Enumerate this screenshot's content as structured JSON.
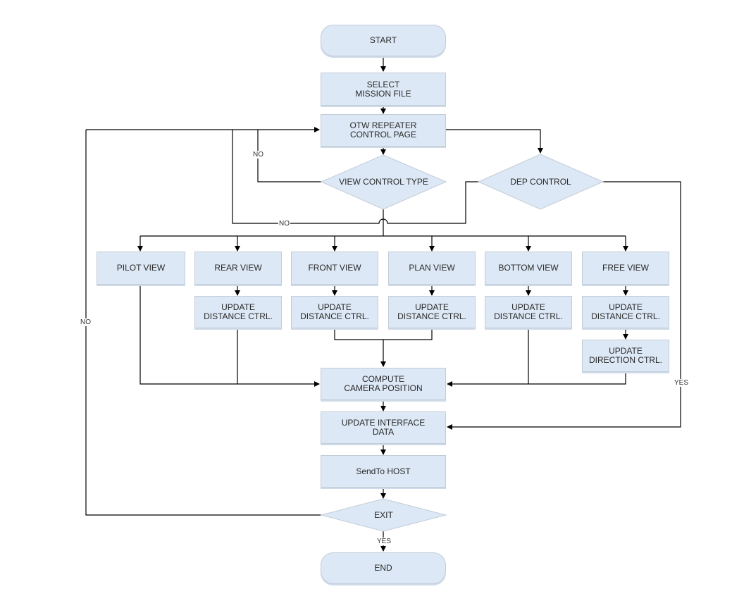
{
  "diagram": {
    "type": "flowchart",
    "nodes": {
      "start": "START",
      "select_mission": "SELECT\nMISSION FILE",
      "otw_control": "OTW REPEATER\nCONTROL PAGE",
      "view_control_type": "VIEW CONTROL TYPE",
      "dep_control": "DEP CONTROL",
      "pilot_view": "PILOT VIEW",
      "rear_view": "REAR VIEW",
      "front_view": "FRONT VIEW",
      "plan_view": "PLAN VIEW",
      "bottom_view": "BOTTOM VIEW",
      "free_view": "FREE VIEW",
      "rear_update_distance": "UPDATE\nDISTANCE CTRL.",
      "front_update_distance": "UPDATE\nDISTANCE CTRL.",
      "plan_update_distance": "UPDATE\nDISTANCE CTRL.",
      "bottom_update_distance": "UPDATE\nDISTANCE CTRL.",
      "free_update_distance": "UPDATE\nDISTANCE CTRL.",
      "free_update_direction": "UPDATE\nDIRECTION CTRL.",
      "compute_camera": "COMPUTE\nCAMERA POSITION",
      "update_interface": "UPDATE INTERFACE\nDATA",
      "send_host": "SendTo HOST",
      "exit": "EXIT",
      "end": "END"
    },
    "edge_labels": {
      "view_type_no": "NO",
      "dep_no": "NO",
      "exit_no": "NO",
      "dep_yes": "YES",
      "exit_yes": "YES"
    },
    "colors": {
      "node_fill": "#dce8f5",
      "node_border": "#c3ccd6",
      "line": "#000000"
    }
  }
}
